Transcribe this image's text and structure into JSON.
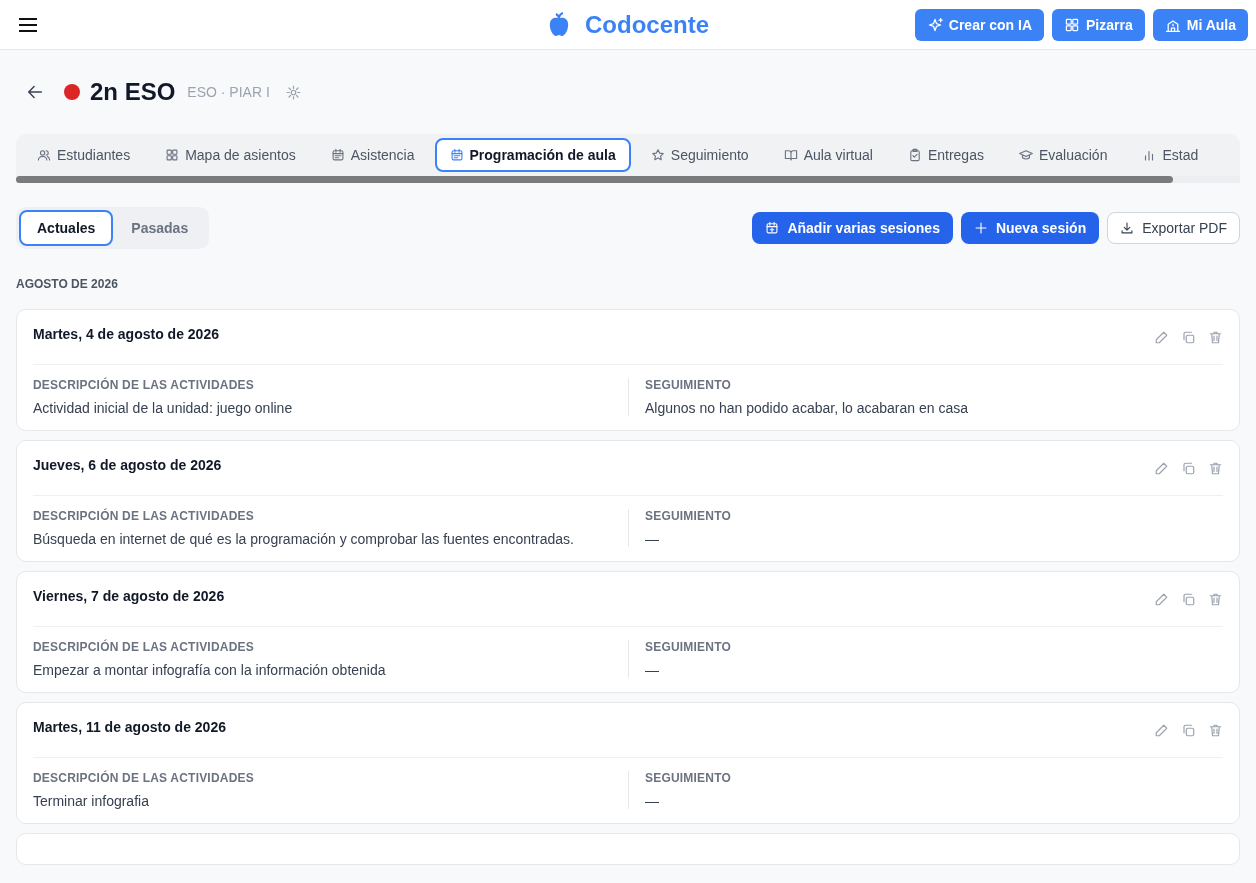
{
  "header": {
    "brand": "Codocente",
    "buttons": [
      {
        "label": "Crear con IA"
      },
      {
        "label": "Pizarra"
      },
      {
        "label": "Mi Aula"
      }
    ]
  },
  "group": {
    "title": "2n ESO",
    "subtitle": "ESO · PIAR I",
    "color": "#dc2626"
  },
  "tabs": [
    {
      "label": "Estudiantes",
      "selected": false
    },
    {
      "label": "Mapa de asientos",
      "selected": false
    },
    {
      "label": "Asistencia",
      "selected": false
    },
    {
      "label": "Programación de aula",
      "selected": true
    },
    {
      "label": "Seguimiento",
      "selected": false
    },
    {
      "label": "Aula virtual",
      "selected": false
    },
    {
      "label": "Entregas",
      "selected": false
    },
    {
      "label": "Evaluación",
      "selected": false
    },
    {
      "label": "Estad",
      "selected": false
    }
  ],
  "filters": [
    {
      "label": "Actuales",
      "selected": true
    },
    {
      "label": "Pasadas",
      "selected": false
    }
  ],
  "actions": [
    {
      "label": "Añadir varias sesiones",
      "kind": "primary"
    },
    {
      "label": "Nueva sesión",
      "kind": "primary"
    },
    {
      "label": "Exportar PDF",
      "kind": "outline"
    }
  ],
  "month": "AGOSTO DE 2026",
  "sessions": [
    {
      "date": "Martes, 4 de agosto de 2026",
      "activities_label": "DESCRIPCIÓN DE LAS ACTIVIDADES",
      "activities": "Actividad inicial de la unidad: juego online",
      "followup_label": "SEGUIMIENTO",
      "followup": "Algunos no han podido acabar, lo acabaran en casa"
    },
    {
      "date": "Jueves, 6 de agosto de 2026",
      "activities_label": "DESCRIPCIÓN DE LAS ACTIVIDADES",
      "activities": "Búsqueda en internet de qué es la programación y comprobar las fuentes encontradas.",
      "followup_label": "SEGUIMIENTO",
      "followup": "—"
    },
    {
      "date": "Viernes, 7 de agosto de 2026",
      "activities_label": "DESCRIPCIÓN DE LAS ACTIVIDADES",
      "activities": "Empezar a montar infografía con la información obtenida",
      "followup_label": "SEGUIMIENTO",
      "followup": "—"
    },
    {
      "date": "Martes, 11 de agosto de 2026",
      "activities_label": "DESCRIPCIÓN DE LAS ACTIVIDADES",
      "activities": "Terminar infografia",
      "followup_label": "SEGUIMIENTO",
      "followup": "—"
    }
  ]
}
